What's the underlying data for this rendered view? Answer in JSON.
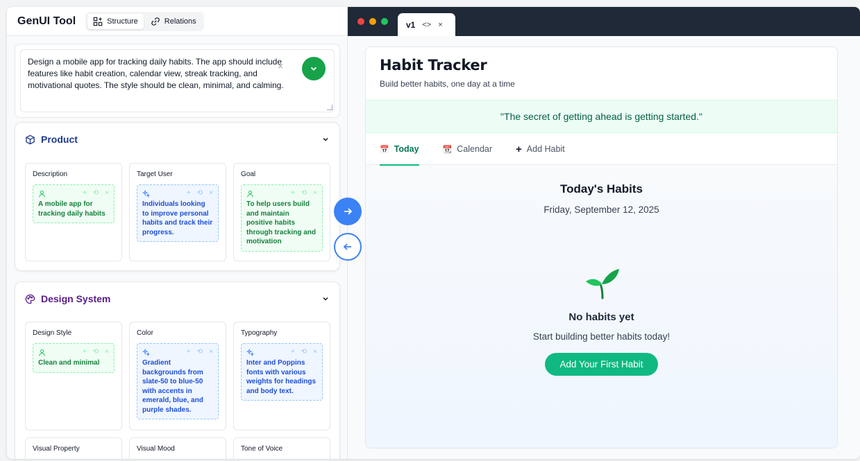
{
  "app": {
    "name": "GenUI Tool",
    "views": [
      {
        "label": "Structure",
        "active": true,
        "icon": "structure-icon"
      },
      {
        "label": "Relations",
        "active": false,
        "icon": "link-icon"
      }
    ]
  },
  "prompt": {
    "text": "Design a mobile app for tracking daily habits. The app should include features like habit creation, calendar view, streak tracking, and motivational quotes. The style should be clean, minimal, and calming.",
    "submit_color": "#16a34a"
  },
  "product": {
    "title": "Product",
    "color": "#1e3a8a",
    "cards": [
      {
        "label": "Description",
        "kind": "green",
        "icon": "user-icon",
        "value": "A mobile app for tracking daily habits"
      },
      {
        "label": "Target User",
        "kind": "blue",
        "icon": "sparkle-icon",
        "value": "Individuals looking to improve personal habits and track their progress."
      },
      {
        "label": "Goal",
        "kind": "green",
        "icon": "user-icon",
        "value": "To help users build and maintain positive habits through tracking and motivation"
      }
    ]
  },
  "design_system": {
    "title": "Design System",
    "color": "#581c87",
    "cards": [
      {
        "label": "Design Style",
        "kind": "green",
        "icon": "user-icon",
        "value": "Clean and minimal"
      },
      {
        "label": "Color",
        "kind": "blue",
        "icon": "sparkle-icon",
        "value": "Gradient backgrounds from slate-50 to blue-50 with accents in emerald, blue, and purple shades."
      },
      {
        "label": "Typography",
        "kind": "blue",
        "icon": "sparkle-icon",
        "value": "Inter and Poppins fonts with various weights for headings and body text."
      }
    ],
    "more_labels": [
      "Visual Property",
      "Visual Mood",
      "Tone of Voice"
    ]
  },
  "chip_actions": [
    "+",
    "⟲",
    "×"
  ],
  "preview": {
    "tab_label": "v1",
    "tab_code": "<>",
    "tab_close": "×",
    "traffic_lights": [
      "#ef4444",
      "#f59e0b",
      "#22c55e"
    ],
    "title": "Habit Tracker",
    "subtitle": "Build better habits, one day at a time",
    "quote": "\"The secret of getting ahead is getting started.\"",
    "tabs": [
      {
        "label": "Today",
        "icon": "📅",
        "active": true
      },
      {
        "label": "Calendar",
        "icon": "📆",
        "active": false
      },
      {
        "label": "Add Habit",
        "icon": "+",
        "active": false
      }
    ],
    "heading": "Today's Habits",
    "date": "Friday, September 12, 2025",
    "empty_title": "No habits yet",
    "empty_sub": "Start building better habits today!",
    "cta": "Add Your First Habit",
    "accent": "#10b981"
  }
}
